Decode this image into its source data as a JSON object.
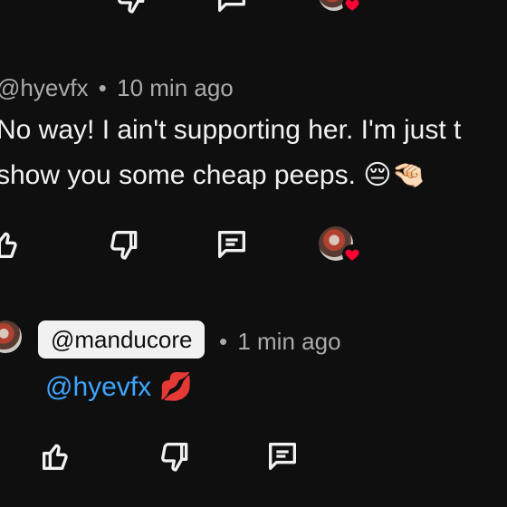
{
  "comments": [
    {
      "username": "@hyevfx",
      "separator": "•",
      "time": "10 min ago",
      "lines": [
        "No way! I ain't supporting her. I'm just t",
        "show you some cheap peeps."
      ],
      "emojis": "😔🤏🏻"
    }
  ],
  "reply": {
    "username": "@manducore",
    "separator": "•",
    "time": "1 min ago",
    "mention": "@hyevfx",
    "emoji": "💋"
  },
  "icons": {
    "like": "thumbs-up-icon",
    "dislike": "thumbs-down-icon",
    "reply": "comment-icon",
    "hearted": "heart-icon"
  },
  "colors": {
    "background": "#0f0f0f",
    "text": "#f1f1f1",
    "meta": "#aaaaaa",
    "link": "#3ea6ff",
    "heart": "#ff0033"
  }
}
